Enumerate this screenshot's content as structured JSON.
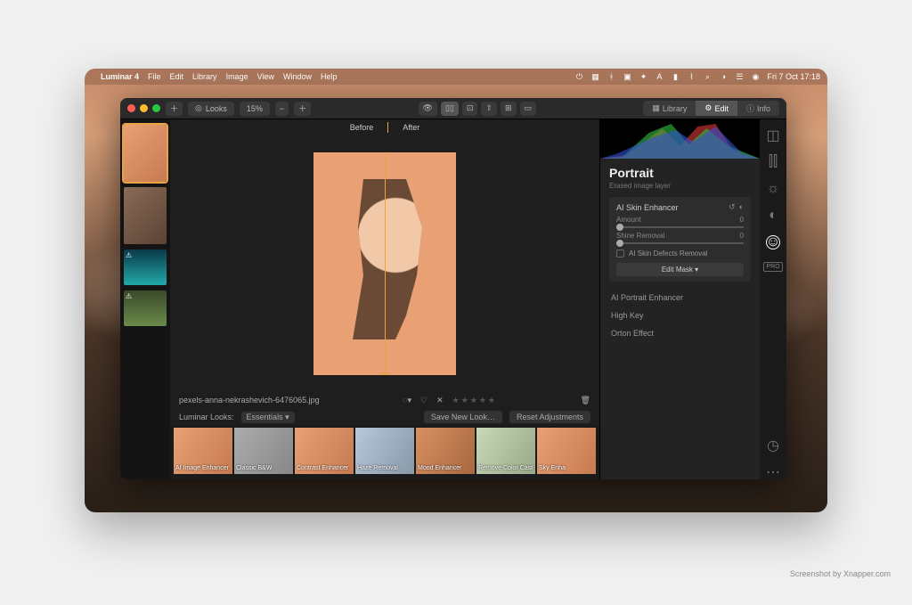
{
  "menubar": {
    "app_name": "Luminar 4",
    "items": [
      "File",
      "Edit",
      "Library",
      "Image",
      "View",
      "Window",
      "Help"
    ],
    "clock": "Fri 7 Oct  17:18"
  },
  "toolbar": {
    "looks_label": "Looks",
    "zoom": "15%",
    "tabs": {
      "library": "Library",
      "edit": "Edit",
      "info": "Info"
    }
  },
  "compare": {
    "before": "Before",
    "after": "After"
  },
  "filename": "pexels-anna-nekrashevich-6476065.jpg",
  "rating_stars": "★★★★★",
  "looks_meta": {
    "label": "Luminar Looks:",
    "category": "Essentials ▾",
    "save": "Save New Look…",
    "reset": "Reset Adjustments"
  },
  "looks": [
    "AI Image Enhancer",
    "Classic B&W",
    "Contrast Enhancer",
    "Haze Removal",
    "Mood Enhancer",
    "Remove Color Cast",
    "Sky Enha"
  ],
  "inspector": {
    "title": "Portrait",
    "subtitle": "Erased image layer",
    "tool": {
      "name": "AI Skin Enhancer",
      "amount_label": "Amount",
      "amount_value": "0",
      "shine_label": "Shine Removal",
      "shine_value": "0",
      "defects_label": "AI Skin Defects Removal",
      "mask_button": "Edit Mask ▾"
    },
    "others": [
      "AI Portrait Enhancer",
      "High Key",
      "Orton Effect"
    ],
    "pro_badge": "PRO"
  },
  "caption": "Screenshot by Xnapper.com"
}
